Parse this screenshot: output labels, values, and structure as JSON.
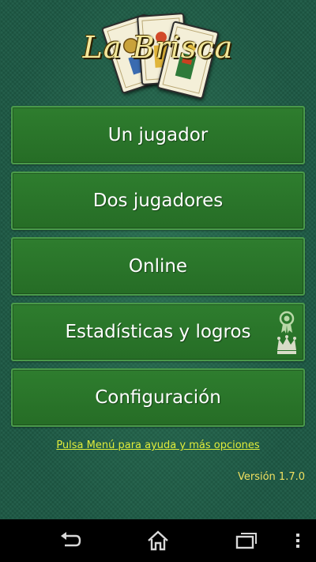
{
  "app": {
    "title": "La Brisca"
  },
  "menu": {
    "items": [
      {
        "label": "Un jugador"
      },
      {
        "label": "Dos jugadores"
      },
      {
        "label": "Online"
      },
      {
        "label": "Estadísticas y logros"
      },
      {
        "label": "Configuración"
      }
    ]
  },
  "footer": {
    "help_text": "Pulsa Menú para ayuda y más opciones",
    "version_text": "Versión 1.7.0"
  },
  "icons": {
    "cards": "playing-cards-icon",
    "medal": "medal-icon",
    "crown": "crown-icon",
    "back": "back-icon",
    "home": "home-icon",
    "recents": "recent-apps-icon",
    "overflow": "overflow-menu-icon"
  },
  "colors": {
    "background": "#1d5a45",
    "button": "#2e7d2e",
    "button_border": "#4a9a4a",
    "title": "#f3e79a",
    "link": "#e0ec3a",
    "version": "#f0e060"
  }
}
